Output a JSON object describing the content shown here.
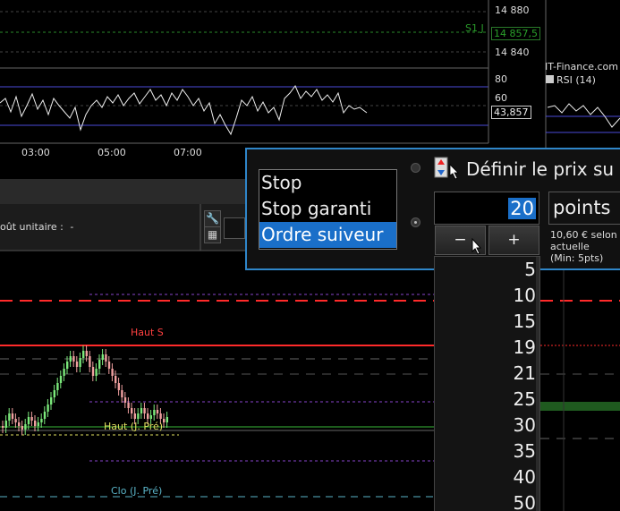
{
  "top_chart": {
    "price_labels": [
      "14 880",
      "14 840"
    ],
    "s1_label": "S1 J",
    "s1_value": "14 857,5",
    "rsi_labels": [
      "80",
      "60"
    ],
    "rsi_value": "43,857",
    "time_labels": [
      "03:00",
      "05:00",
      "07:00"
    ]
  },
  "right_panel": {
    "brand": "IT-Finance.com",
    "rsi_legend": "RSI (14)"
  },
  "toolbar": {
    "unit_cost_label": "oût unitaire :",
    "unit_cost_value": "-"
  },
  "main_chart": {
    "haut_s": "Haut S",
    "haut_j_pre": "Haut (J. Pré)",
    "clo_j_pre": "Clo (J. Pré)"
  },
  "popup": {
    "title": "Définir le prix su",
    "order_types": [
      "Stop",
      "Stop garanti",
      "Ordre suiveur"
    ],
    "selected_order_type": "Ordre suiveur",
    "distance_value": "20",
    "unit": "points",
    "minus": "−",
    "plus": "+",
    "info_line1": "10,60 € selon",
    "info_line2": "actuelle",
    "info_line3": "(Min: 5pts)",
    "options": [
      "5",
      "10",
      "15",
      "19",
      "21",
      "25",
      "30",
      "35",
      "40",
      "50"
    ]
  },
  "colors": {
    "accent": "#1a6fc9",
    "border_blue": "#2f86c9",
    "red_line": "#ff2a2a",
    "green_candle": "#7be87b",
    "red_candle": "#f0a0a0",
    "purple_line": "#8844cc",
    "green_line": "#39b839",
    "yellow": "#e0e060",
    "cyan": "#5ab4c8"
  }
}
